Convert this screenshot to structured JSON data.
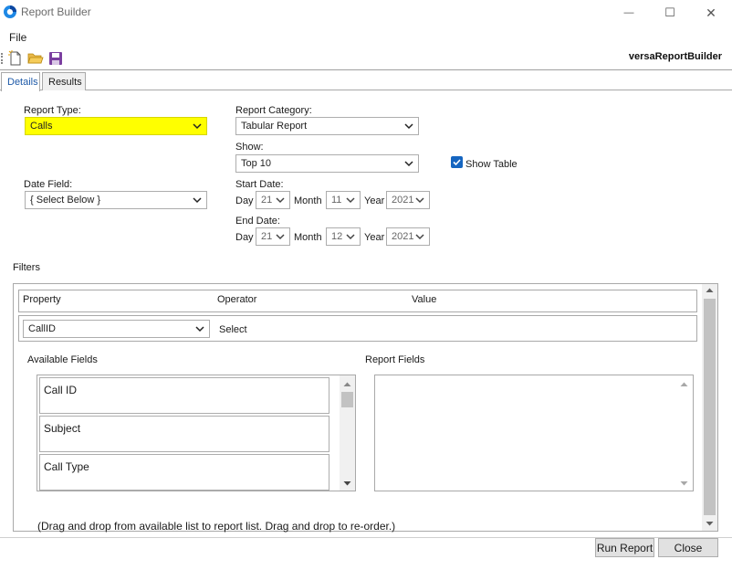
{
  "window": {
    "title": "Report Builder",
    "minimize_glyph": "—",
    "maximize_glyph": "☐",
    "close_glyph": "✕"
  },
  "menu": {
    "file": "File"
  },
  "toolbar": {
    "app_name": "versaReportBuilder"
  },
  "tabs": [
    {
      "label": "Details",
      "active": true
    },
    {
      "label": "Results",
      "active": false
    }
  ],
  "form": {
    "report_type": {
      "label": "Report Type:",
      "value": "Calls"
    },
    "report_category": {
      "label": "Report Category:",
      "value": "Tabular Report"
    },
    "show": {
      "label": "Show:",
      "value": "Top 10"
    },
    "show_table": {
      "label": "Show Table",
      "checked": true
    },
    "date_field": {
      "label": "Date Field:",
      "value": "{ Select Below }"
    },
    "start_date": {
      "label": "Start Date:",
      "day_label": "Day",
      "day": "21",
      "month_label": "Month",
      "month": "11",
      "year_label": "Year",
      "year": "2021"
    },
    "end_date": {
      "label": "End Date:",
      "day_label": "Day",
      "day": "21",
      "month_label": "Month",
      "month": "12",
      "year_label": "Year",
      "year": "2021"
    }
  },
  "filters": {
    "label": "Filters",
    "columns": [
      "Property",
      "Operator",
      "Value"
    ],
    "row": {
      "property": "CallID",
      "operator": "Select"
    }
  },
  "available_fields": {
    "label": "Available Fields",
    "items": [
      "Call ID",
      "Subject",
      "Call Type"
    ]
  },
  "report_fields": {
    "label": "Report Fields",
    "items": []
  },
  "hint": "(Drag and drop from available list to report list. Drag and drop to re-order.)",
  "buttons": {
    "run": "Run Report",
    "close": "Close"
  },
  "colors": {
    "highlight": "#ffff00",
    "accent": "#1e5aa8",
    "checkbox": "#1565c0"
  }
}
